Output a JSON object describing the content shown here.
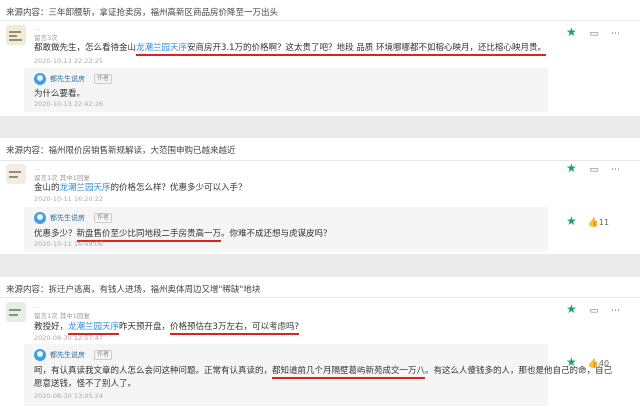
{
  "sections": [
    {
      "source_label": "来源内容：",
      "source_title": "三年卸腰斩，拿证抢卖房，福州高新区商品房价降至一万出头",
      "comment": {
        "meta_left": "...",
        "meta_right": "留言3次",
        "text_pre": "都敢做先生，怎么看待金山",
        "link": "龙潮兰园天序",
        "text_mid": "安商房开3.1万的价格啊？这太贵了吧？地段 品质 环境哪哪都不如榕心映月，还比榕心映月贵。",
        "time": "2020-10-13 22:22:25"
      },
      "reply": {
        "author": "都先生说房",
        "badge": "作者",
        "text": "为什么要看。",
        "time": "2020-10-13 22:42:26"
      }
    },
    {
      "source_label": "来源内容：",
      "source_title": "福州限价房销售新规解读，大范围申购已越来越近",
      "comment": {
        "meta_left": "...",
        "meta_right": "留言1次  其中1回复",
        "text_pre": "金山的",
        "link": "龙潮兰园天序",
        "text_mid": "的价格怎么样？优惠多少可以入手？",
        "time": "2020-10-11 16:20:22"
      },
      "reply": {
        "author": "都先生说房",
        "badge": "作者",
        "text_pre": "优惠多少？",
        "text_mark": "新盘售价至少比同地段二手房贵高一万",
        "text_post": "。你难不成还想与虎谋皮吗？",
        "time": "2020-10-11 16:49:06",
        "likes": "11"
      }
    },
    {
      "source_label": "来源内容：",
      "source_title": "拆迁户逃离，有钱人进场，福州奥体周边又增\"稀缺\"地块",
      "comment": {
        "meta_left": "...",
        "meta_right": "留言1次  其中1回复",
        "text_pre": "教授好，",
        "link": "龙潮兰园天序",
        "text_mid": "昨天预开盘，",
        "text_mark": "价格预估在3万左右，可以考虑吗?",
        "time": "2020-08-30 12:57:47"
      },
      "reply": {
        "author": "都先生说房",
        "badge": "作者",
        "text_pre": "呵，有认真读我文章的人怎么会问这种问题。正常有认真读的，",
        "text_mark": "都知道前几个月隔壁葛屿新苑成交一万八",
        "text_post": "。有这么人傻钱多的人，那也是他自己的命，自己",
        "text_line2": "愿意送钱，怪不了别人了。",
        "time": "2020-08-30 13:05:24",
        "likes": "40"
      }
    }
  ],
  "icons": {
    "star": "star-icon",
    "comment": "comment-icon",
    "more": "more-icon",
    "like": "thumbs-up-icon"
  },
  "colors": {
    "link": "#2f8ddb",
    "underline": "#dd2222",
    "star": "#1aa466",
    "page_bg": "#ebebeb"
  }
}
